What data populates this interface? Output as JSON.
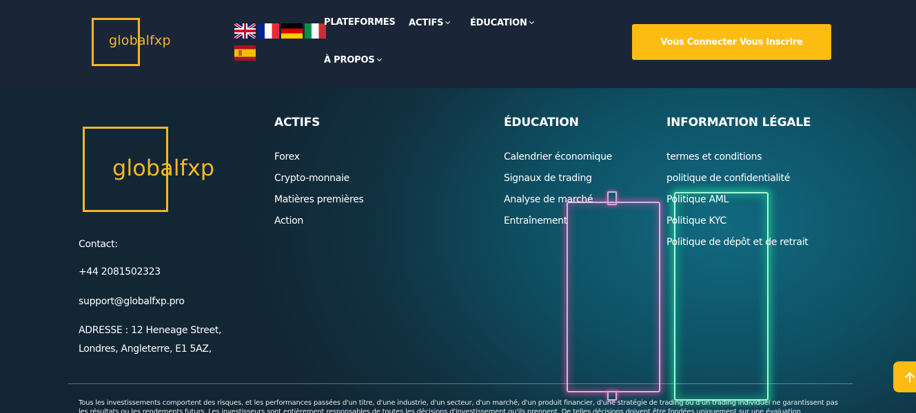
{
  "header": {
    "logo_text": "globalfxp",
    "flags": [
      "united-kingdom-flag-icon",
      "france-flag-icon",
      "germany-flag-icon",
      "italy-flag-icon",
      "spain-flag-icon"
    ],
    "nav": {
      "plateformes": "PLATEFORMES",
      "actifs": "ACTIFS",
      "education": "ÉDUCATION",
      "apropos": "À PROPOS"
    },
    "cta_label": "Vous Connecter Vous Inscrire"
  },
  "footer": {
    "logo_text": "globalfxp",
    "contact": {
      "label": "Contact:",
      "phone": "+44 2081502323",
      "email": "support@globalfxp.pro",
      "address_line1": "ADRESSE : 12 Heneage Street,",
      "address_line2": "Londres, Angleterre, E1 5AZ,"
    },
    "columns": {
      "actifs": {
        "heading": "ACTIFS",
        "links": [
          "Forex",
          "Crypto-monnaie",
          "Matières premières",
          "Action"
        ]
      },
      "education": {
        "heading": "ÉDUCATION",
        "links": [
          "Calendrier économique",
          "Signaux de trading",
          "Analyse de marché",
          "Entraînement"
        ]
      },
      "legal": {
        "heading": "INFORMATION LÉGALE",
        "links": [
          "termes et conditions",
          "politique de confidentialité",
          "Politique AML",
          "Politique KYC",
          "Politique de dépôt et de retrait"
        ]
      }
    },
    "disclaimer": "Tous les investissements comportent des risques, et les performances passées d'un titre, d'une industrie, d'un secteur, d'un marché, d'un produit financier, d'une stratégie de trading ou d'un trading individuel ne garantissent pas les résultats ou les rendements futurs. Les investisseurs sont entièrement responsables de toutes les décisions d'investissement qu'ils prennent. De telles décisions doivent être fondées uniquement sur une évaluation"
  },
  "colors": {
    "header_bg": "#1a2637",
    "accent": "#fdbc11",
    "logo_gold": "#f4b728",
    "footer_bg": "#0e4f63"
  },
  "icons": {
    "caret": "chevron-down-icon",
    "scroll_top": "arrow-up-icon"
  }
}
